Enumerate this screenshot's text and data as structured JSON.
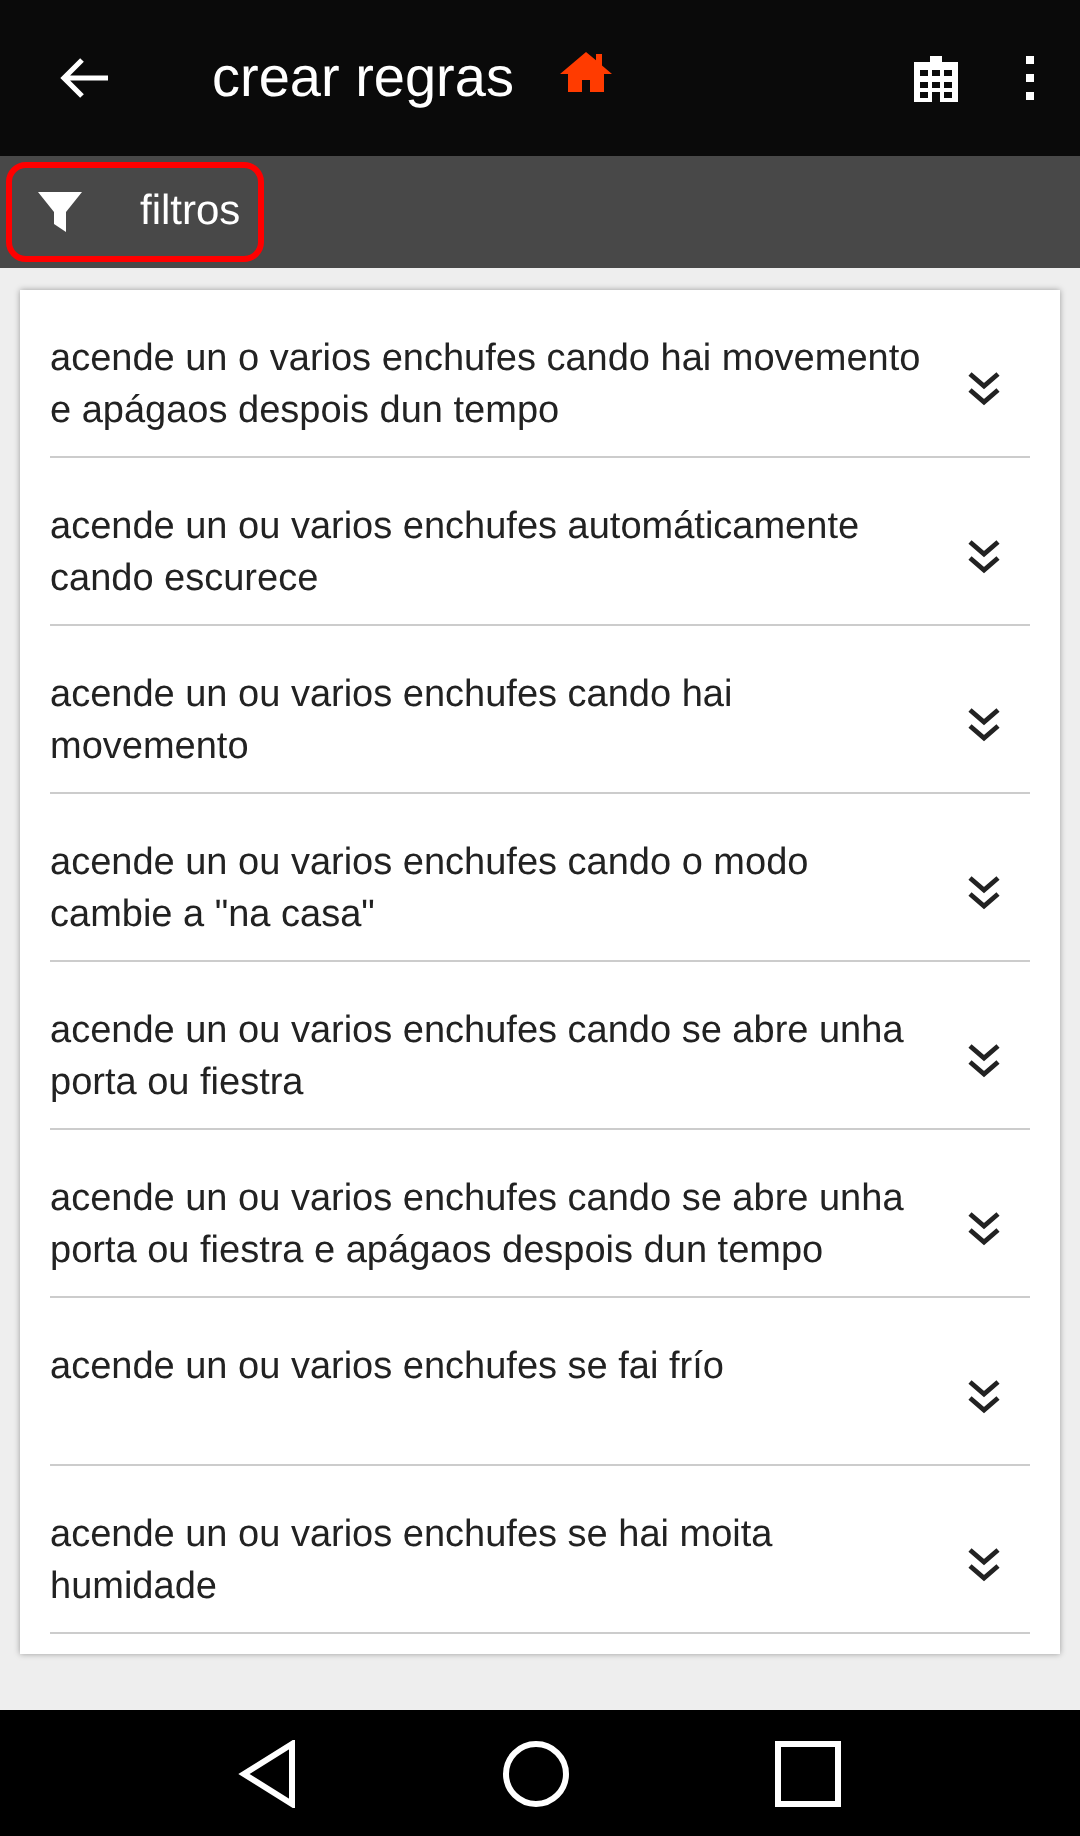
{
  "app_bar": {
    "title": "crear regras"
  },
  "filter_button": {
    "label": "filtros"
  },
  "rules": [
    {
      "text": "acende un o varios enchufes cando hai movemento e apágaos despois dun tempo"
    },
    {
      "text": "acende un ou varios enchufes automáticamente cando escurece"
    },
    {
      "text": "acende un ou varios enchufes cando hai movemento"
    },
    {
      "text": "acende un ou varios enchufes cando o modo cambie a \"na casa\""
    },
    {
      "text": "acende un ou varios enchufes cando se abre unha porta ou fiestra"
    },
    {
      "text": "acende un ou varios enchufes cando se abre unha porta ou fiestra e apágaos despois dun tempo"
    },
    {
      "text": "acende un ou varios enchufes se fai frío"
    },
    {
      "text": "acende un ou varios enchufes se hai moita humidade"
    }
  ]
}
